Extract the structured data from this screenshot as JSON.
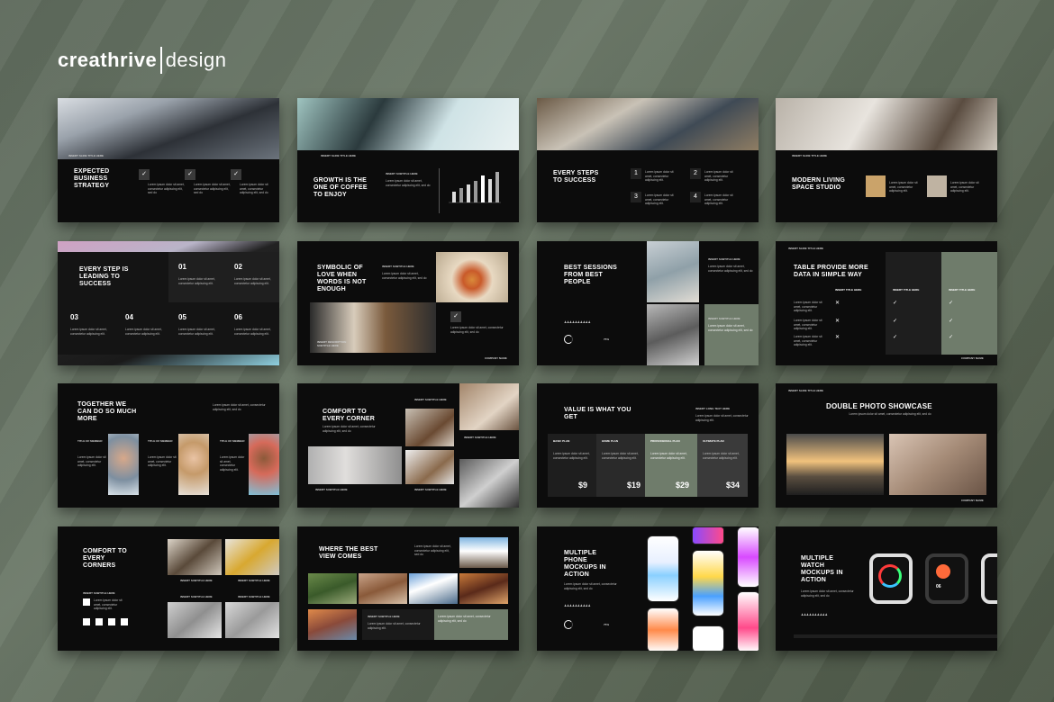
{
  "brand": {
    "name_bold": "creathrive",
    "name_light": "design"
  },
  "common": {
    "slide_title": "INSERT SLIDE TITLE HERE",
    "subtitle": "INSERT SUBTITLE HERE",
    "company": "COMPANY NAME",
    "body": "Lorem ipsum dolor sit amet, consectetur adipiscing elit, sed do",
    "short": "Lorem ipsum dolor sit amet, consectetur adipiscing elit."
  },
  "slides": {
    "s1": {
      "title": "EXPECTED BUSINESS STRATEGY",
      "check": "✓"
    },
    "s2": {
      "title": "GROWTH IS THE ONE OF COFFEE TO ENJOY"
    },
    "s3": {
      "title": "EVERY STEPS TO SUCCESS",
      "nums": [
        "1",
        "2",
        "3",
        "4"
      ]
    },
    "s4": {
      "title": "MODERN LIVING SPACE STUDIO"
    },
    "s5": {
      "title": "EVERY STEP IS LEADING TO SUCCESS",
      "nums": [
        "01",
        "02",
        "03",
        "04",
        "05",
        "06"
      ]
    },
    "s6": {
      "title": "SYMBOLIC OF LOVE WHEN WORDS IS NOT ENOUGH",
      "desc": "INSERT DESCRIPTION SUBTITLE HERE"
    },
    "s7": {
      "title": "BEST SESSIONS FROM BEST PEOPLE",
      "percent": "75%"
    },
    "s8": {
      "title": "TABLE PROVIDE MORE DATA IN SIMPLE WAY",
      "cols": [
        "INSERT TITLE HERE",
        "INSERT TITLE HERE",
        "INSERT TITLE HERE"
      ]
    },
    "s9": {
      "title": "TOGETHER WE CAN DO SO MUCH MORE",
      "name": "Title of member"
    },
    "s10": {
      "title": "COMFORT TO EVERY CORNER"
    },
    "s11": {
      "title": "VALUE IS WHAT YOU GET",
      "long_title": "INSERT LONG TEXT HERE",
      "plans": [
        "BASIC PLAN",
        "HOME PLAN",
        "PROFESSIONAL PLAN",
        "ULTIMATE PLAN"
      ],
      "prices": [
        "$9",
        "$19",
        "$29",
        "$34"
      ]
    },
    "s12": {
      "title": "DOUBLE PHOTO SHOWCASE"
    },
    "s13": {
      "title": "COMFORT TO EVERY CORNERS"
    },
    "s14": {
      "title": "WHERE THE BEST VIEW COMES"
    },
    "s15": {
      "title": "MULTIPLE PHONE MOCKUPS IN ACTION",
      "percent": "75%"
    },
    "s16": {
      "title": "MULTIPLE WATCH MOCKUPS IN ACTION",
      "watch_num": "06"
    }
  },
  "colors": {
    "sage": "#6f7c6b",
    "dark": "#0c0c0c",
    "panel": "#2a2a2a"
  }
}
